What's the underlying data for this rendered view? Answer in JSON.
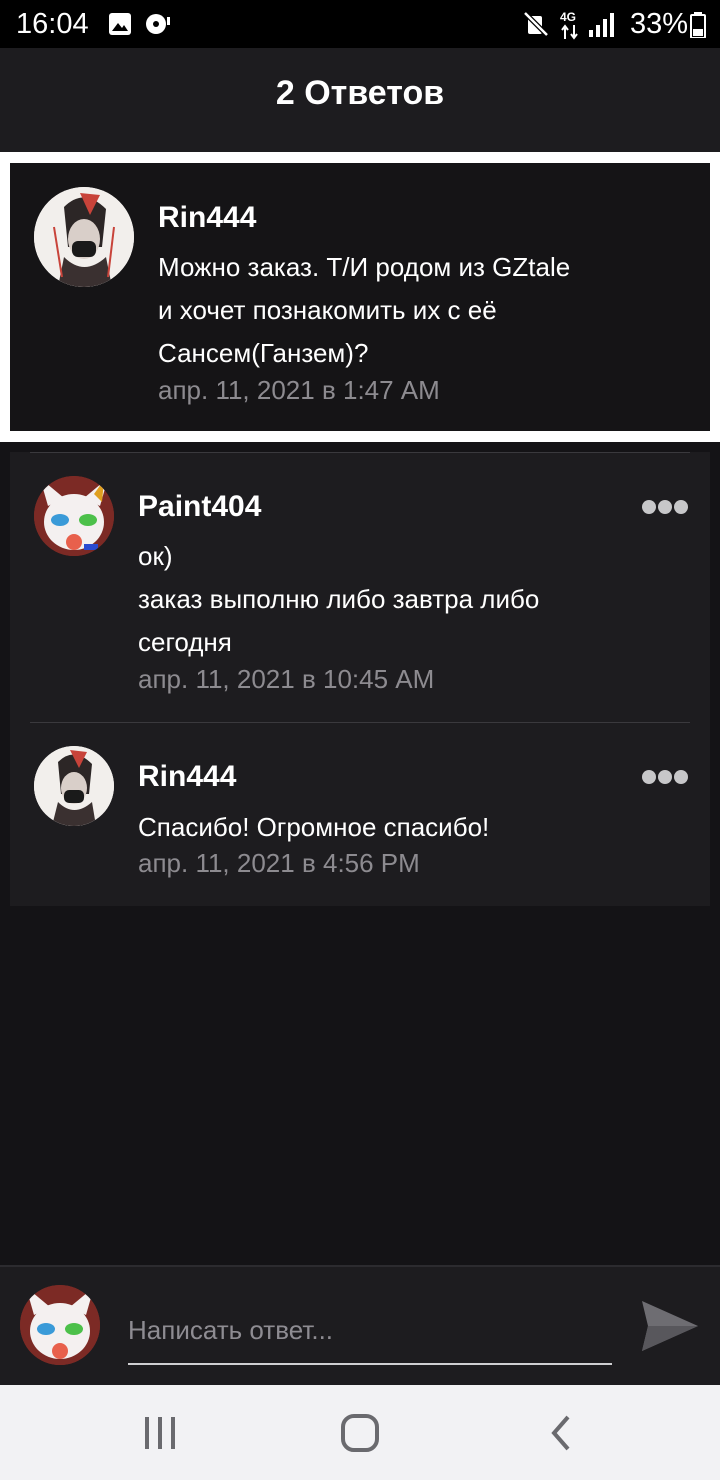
{
  "status_bar": {
    "time": "16:04",
    "network": "4G",
    "battery": "33%",
    "icons": [
      "image-icon",
      "media-icon",
      "mute-icon",
      "data-arrows-icon",
      "signal-icon",
      "battery-icon"
    ]
  },
  "header": {
    "title": "2 Ответов"
  },
  "parent_comment": {
    "author": "Rin444",
    "lines": [
      "Можно заказ. Т/И родом из GZtale",
      "и хочет познакомить их с её",
      "Сансем(Ганзем)?"
    ],
    "date": "апр. 11, 2021 в 1:47 AM"
  },
  "replies": [
    {
      "author": "Paint404",
      "lines": [
        "ок)",
        "заказ выполню либо завтра либо",
        "сегодня"
      ],
      "date": "апр. 11, 2021 в 10:45 AM"
    },
    {
      "author": "Rin444",
      "lines": [
        "Спасибо! Огромное спасибо!"
      ],
      "date": "апр. 11, 2021 в 4:56 PM"
    }
  ],
  "composer": {
    "placeholder": "Написать ответ..."
  },
  "colors": {
    "background": "#141316",
    "panel": "#1d1c1f",
    "date_text": "#8d8b90"
  }
}
